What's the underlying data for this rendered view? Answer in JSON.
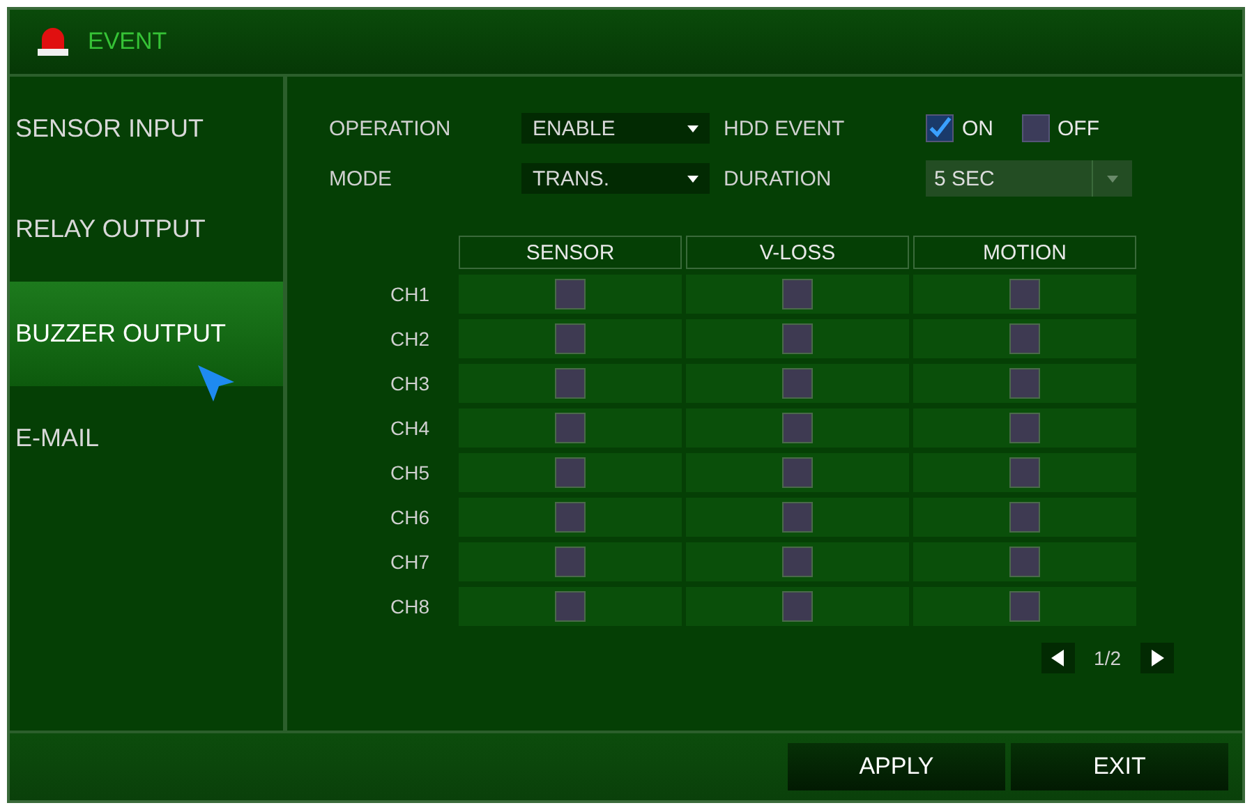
{
  "window": {
    "title": "EVENT"
  },
  "sidebar": {
    "items": [
      {
        "label": "SENSOR INPUT",
        "selected": false
      },
      {
        "label": "RELAY OUTPUT",
        "selected": false
      },
      {
        "label": "BUZZER OUTPUT",
        "selected": true
      },
      {
        "label": "E-MAIL",
        "selected": false
      }
    ]
  },
  "settings": {
    "operation": {
      "label": "OPERATION",
      "value": "ENABLE"
    },
    "mode": {
      "label": "MODE",
      "value": "TRANS."
    },
    "hdd_event": {
      "label": "HDD EVENT",
      "options": [
        {
          "label": "ON",
          "checked": true
        },
        {
          "label": "OFF",
          "checked": false
        }
      ]
    },
    "duration": {
      "label": "DURATION",
      "value": "5 SEC",
      "disabled": true
    }
  },
  "table": {
    "columns": [
      "SENSOR",
      "V-LOSS",
      "MOTION"
    ],
    "rows": [
      {
        "label": "CH1",
        "checks": [
          false,
          false,
          false
        ]
      },
      {
        "label": "CH2",
        "checks": [
          false,
          false,
          false
        ]
      },
      {
        "label": "CH3",
        "checks": [
          false,
          false,
          false
        ]
      },
      {
        "label": "CH4",
        "checks": [
          false,
          false,
          false
        ]
      },
      {
        "label": "CH5",
        "checks": [
          false,
          false,
          false
        ]
      },
      {
        "label": "CH6",
        "checks": [
          false,
          false,
          false
        ]
      },
      {
        "label": "CH7",
        "checks": [
          false,
          false,
          false
        ]
      },
      {
        "label": "CH8",
        "checks": [
          false,
          false,
          false
        ]
      }
    ]
  },
  "pager": {
    "text": "1/2"
  },
  "buttons": [
    "APPLY",
    "EXIT"
  ]
}
